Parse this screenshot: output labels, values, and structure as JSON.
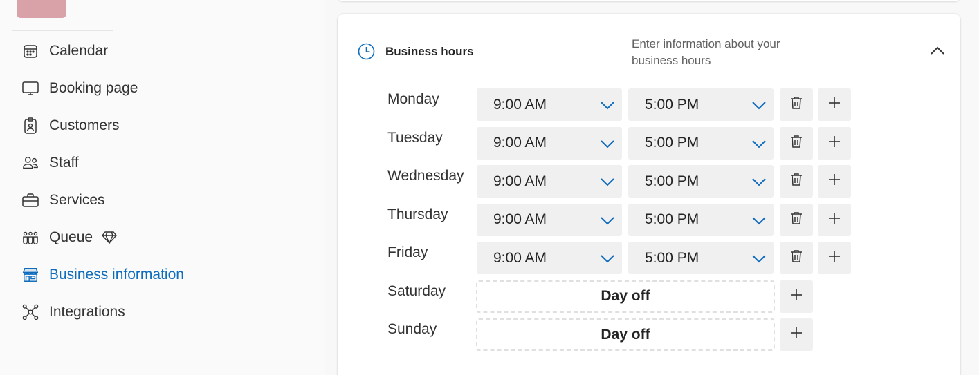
{
  "sidebar": {
    "items": [
      {
        "label": "Calendar",
        "icon": "calendar-icon",
        "active": false
      },
      {
        "label": "Booking page",
        "icon": "monitor-icon",
        "active": false
      },
      {
        "label": "Customers",
        "icon": "badge-icon",
        "active": false
      },
      {
        "label": "Staff",
        "icon": "people-icon",
        "active": false
      },
      {
        "label": "Services",
        "icon": "briefcase-icon",
        "active": false
      },
      {
        "label": "Queue",
        "icon": "people-queue-icon",
        "active": false,
        "premium": true
      },
      {
        "label": "Business information",
        "icon": "storefront-icon",
        "active": true
      },
      {
        "label": "Integrations",
        "icon": "network-icon",
        "active": false
      }
    ]
  },
  "section": {
    "title": "Business hours",
    "description": "Enter information about your business hours",
    "icon": "clock-icon",
    "expanded": true
  },
  "hours": [
    {
      "day": "Monday",
      "start": "9:00 AM",
      "end": "5:00 PM"
    },
    {
      "day": "Tuesday",
      "start": "9:00 AM",
      "end": "5:00 PM"
    },
    {
      "day": "Wednesday",
      "start": "9:00 AM",
      "end": "5:00 PM"
    },
    {
      "day": "Thursday",
      "start": "9:00 AM",
      "end": "5:00 PM"
    },
    {
      "day": "Friday",
      "start": "9:00 AM",
      "end": "5:00 PM"
    },
    {
      "day": "Saturday",
      "off_label": "Day off"
    },
    {
      "day": "Sunday",
      "off_label": "Day off"
    }
  ],
  "colors": {
    "accent": "#0f6cbd",
    "avatar": "#d9a2a9",
    "field_bg": "#f0f0f0"
  }
}
